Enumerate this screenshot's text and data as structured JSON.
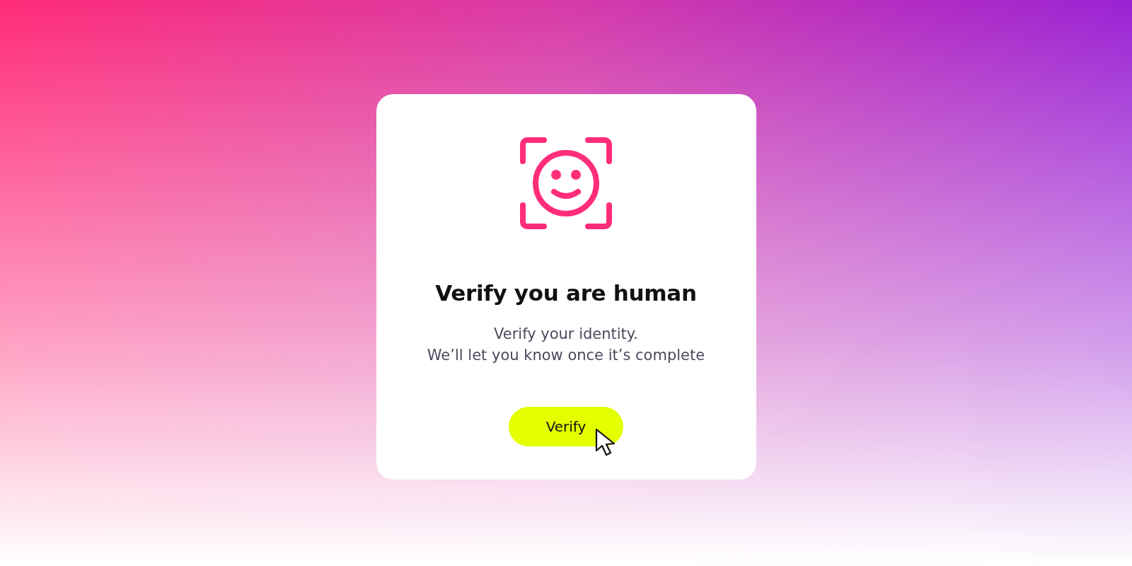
{
  "dialog": {
    "title": "Verify you are human",
    "message": "Verify your identity.\nWe’ll let you know once it’s complete",
    "button": "Verify"
  }
}
